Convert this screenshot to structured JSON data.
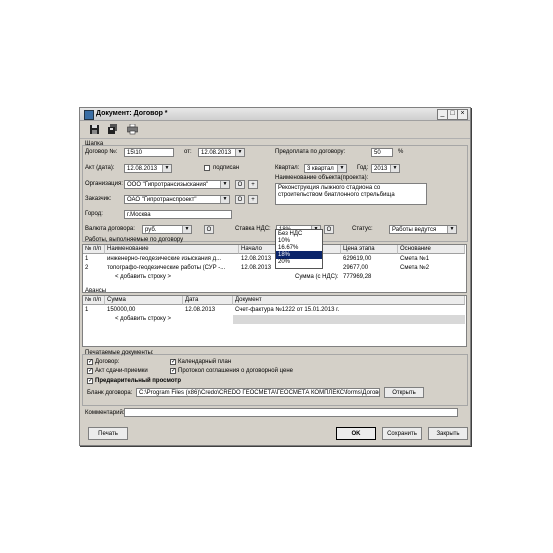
{
  "window": {
    "title": "Документ: Договор *",
    "controls": {
      "minimize": "_",
      "maximize": "□",
      "close": "×"
    }
  },
  "toolbar": {
    "icons": [
      "save-icon",
      "save-all-icon",
      "print-icon"
    ]
  },
  "header_group": {
    "label": "Шапка",
    "contract_label": "Договор №:",
    "contract_value": "15\\10",
    "from_label": "от:",
    "from_value": "12.08.2013",
    "prepay_label": "Предоплата по договору:",
    "prepay_value": "50",
    "prepay_unit": "%",
    "act_label": "Акт (дата):",
    "act_value": "12.08.2013",
    "signed_label": "подписан",
    "quarter_label": "Квартал:",
    "quarter_value": "3 квартал",
    "year_label": "Год:",
    "year_value": "2013",
    "org_label": "Организация:",
    "org_value": "ООО \"Гипротрансизыскания\"",
    "object_label": "Наименование объекта(проекта):",
    "object_value": "Реконструкция лыжного стадиона со строительством биатлонного стрельбища",
    "customer_label": "Заказчик:",
    "customer_value": "ОАО \"Гипротранспроект\"",
    "city_label": "Город:",
    "city_value": "г.Москва",
    "currency_label": "Валюта договора:",
    "currency_value": "руб.",
    "vat_label": "Ставка НДС:",
    "vat_value": "18%",
    "status_label": "Статус:",
    "status_value": "Работы ведутся",
    "open_btn": "O",
    "plus_btn": "+"
  },
  "vat_options": [
    "Без НДС",
    "10%",
    "16.67%",
    "18%",
    "20%"
  ],
  "vat_selected_index": 3,
  "works_group": {
    "label": "Работы, выполняемые по договору",
    "columns": [
      "№ п/п",
      "Наименование",
      "Начало",
      "",
      "Цена этапа",
      "Основание"
    ],
    "rows": [
      [
        "1",
        "инженерно-геодезические изыскания д...",
        "12.08.2013",
        "",
        "629619,00",
        "Смета №1"
      ],
      [
        "2",
        "топографо-геодезические работы (СУР -...",
        "12.08.2013",
        "",
        "29677,00",
        "Смета №2"
      ]
    ],
    "add_row": "< добавить строку >",
    "total_label": "Сумма (с НДС):",
    "total_value": "777969,28"
  },
  "advances_group": {
    "label": "Авансы",
    "columns": [
      "№ п/п",
      "Сумма",
      "Дата",
      "Документ"
    ],
    "rows": [
      [
        "1",
        "150000,00",
        "12.08.2013",
        "Счет-фактура №1222 от 15.01.2013 г."
      ]
    ],
    "add_row": "< добавить строку >"
  },
  "print_group": {
    "label": "Печатаемые документы:",
    "items": [
      {
        "label": "Договор:",
        "checked": true
      },
      {
        "label": "Календарный план",
        "checked": true
      },
      {
        "label": "Акт сдачи-приемки",
        "checked": true
      },
      {
        "label": "Протокол соглашения о договорной цене",
        "checked": true
      }
    ],
    "preview_label": "Предварительный просмотр",
    "template_label": "Бланк договора:",
    "template_path": "C:\\Program Files (x86)\\Credo\\CREDO ГЕОСМЕТА\\ГЕОСМЕТА КОМПЛЕКС\\forms\\Догово",
    "open_label": "Открыть"
  },
  "comment_label": "Комментарий:",
  "buttons": {
    "print": "Печать",
    "ok": "OK",
    "save": "Сохранить",
    "close": "Закрыть"
  }
}
